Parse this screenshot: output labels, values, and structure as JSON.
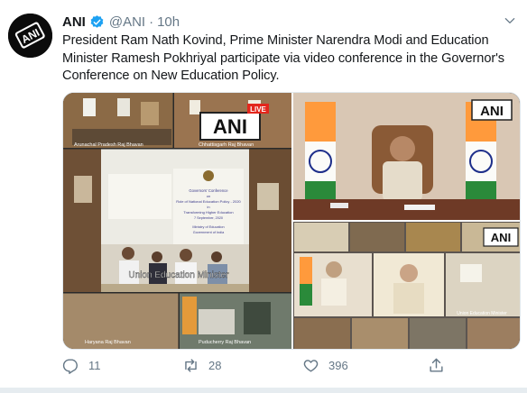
{
  "tweet": {
    "author": {
      "avatar_icon": "ani-logo-icon",
      "name": "ANI",
      "verified_icon": "verified-badge-icon",
      "handle": "@ANI",
      "separator": "·",
      "time": "10h"
    },
    "menu_icon": "chevron-down-icon",
    "text_lines": [
      "President Ram Nath Kovind, Prime Minister Narendra Modi and Education",
      "Minister Ramesh Pokhriyal participate via video conference in the Governor's",
      "Conference on New Education Policy."
    ],
    "media": {
      "watermark": "ANI",
      "live_tag": "LIVE",
      "captions": {
        "arunachal": "Arunachal Pradesh Raj Bhavan",
        "chhattisgarh": "Chhattisgarh Raj Bhavan",
        "union_minister": "Union Education Minister",
        "haryana": "Haryana Raj Bhavan",
        "puducherry": "Puducherry Raj Bhavan",
        "union_minister_small": "Union Education Minister"
      },
      "banner": {
        "line1": "Governors' Conference",
        "line2": "on",
        "line3": "Role of National Education Policy - 2020",
        "line4": "in",
        "line5": "Transforming Higher Education",
        "line6": "7 September, 2020",
        "line7": "Ministry of Education",
        "line8": "Government of India"
      }
    },
    "actions": [
      {
        "icon": "reply-icon",
        "count": "11"
      },
      {
        "icon": "retweet-icon",
        "count": "28"
      },
      {
        "icon": "like-icon",
        "count": "396"
      },
      {
        "icon": "share-icon",
        "count": ""
      }
    ],
    "colors": {
      "verified": "#1da1f2",
      "meta_gray": "#657786",
      "text": "#14171a",
      "ani_red": "#e3261c"
    }
  }
}
